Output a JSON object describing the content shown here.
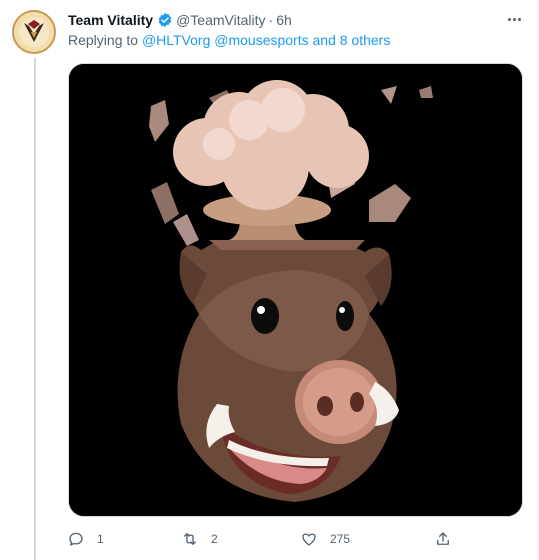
{
  "tweet": {
    "display_name": "Team Vitality",
    "handle": "@TeamVitality",
    "separator": "·",
    "time": "6h",
    "verified": true,
    "avatar_icon": "team-vitality-logo"
  },
  "reply": {
    "prefix": "Replying to ",
    "mention_1": "@HLTVorg",
    "mention_2": "@mousesports",
    "others": "and 8 others"
  },
  "media": {
    "description_icon": "exploding-head-boar-memoji"
  },
  "actions": {
    "reply_count": "1",
    "retweet_count": "2",
    "like_count": "275",
    "share_count": ""
  },
  "colors": {
    "link": "#1d9bf0",
    "muted": "#536471",
    "text": "#0f1419",
    "media_bg": "#000000"
  }
}
